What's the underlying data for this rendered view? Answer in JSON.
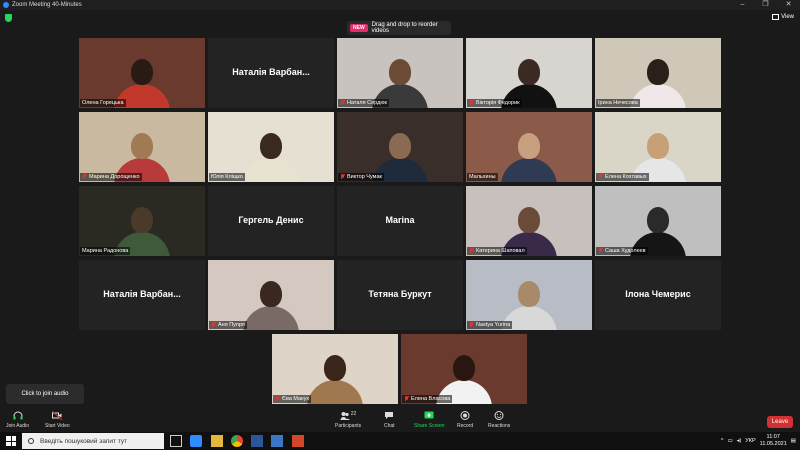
{
  "window": {
    "title": "Zoom Meeting 40-Minutes",
    "controls": [
      "–",
      "❐",
      "✕"
    ]
  },
  "banner": {
    "badge": "NEW",
    "text": "Drag and drop to reorder videos"
  },
  "view_label": "View",
  "tiles": [
    {
      "name": "Олена Горецька",
      "type": "video",
      "muted": false,
      "active": true,
      "bg": "#6b3a2e",
      "head": "#2a1a14",
      "body": "#c0392b"
    },
    {
      "name": "Наталія Варбан...",
      "type": "name"
    },
    {
      "name": "Наталя Сердюк",
      "type": "video",
      "muted": true,
      "bg": "#c9c3bf",
      "head": "#6b4a36",
      "body": "#3a3a3a"
    },
    {
      "name": "Вікторія Федорик",
      "type": "video",
      "muted": true,
      "bg": "#d8d4cf",
      "head": "#3b2a22",
      "body": "#111111"
    },
    {
      "name": "Ірина Нечесова",
      "type": "video",
      "muted": false,
      "bg": "#cfc7b8",
      "head": "#2a201a",
      "body": "#f0e8e8"
    },
    {
      "name": "Марина Дорощенко",
      "type": "video",
      "muted": true,
      "bg": "#c8b9a0",
      "head": "#a07a55",
      "body": "#b83a3a"
    },
    {
      "name": "Юлія Кліщко",
      "type": "video",
      "muted": false,
      "bg": "#e5e0d2",
      "head": "#3a2a1e",
      "body": "#e8e2d0"
    },
    {
      "name": "Виктор Чумак",
      "type": "video",
      "muted": true,
      "bg": "#3a2e2a",
      "head": "#8a6a50",
      "body": "#1f2a3a"
    },
    {
      "name": "Мальхины",
      "type": "video",
      "muted": false,
      "bg": "#8c5a48",
      "head": "#c8a080",
      "body": "#2f3b52"
    },
    {
      "name": "Елена Кохтавых",
      "type": "video",
      "muted": true,
      "bg": "#d9d6c8",
      "head": "#c8a078",
      "body": "#e6e6e6"
    },
    {
      "name": "Марина Радонова",
      "type": "video",
      "muted": false,
      "bg": "#2a2a22",
      "head": "#4a3a2a",
      "body": "#3f5a3a"
    },
    {
      "name": "Гергель Денис",
      "type": "name"
    },
    {
      "name": "Marina",
      "type": "name"
    },
    {
      "name": "Катерина Шаповал",
      "type": "video",
      "muted": true,
      "bg": "#c7c0bd",
      "head": "#6a4a38",
      "body": "#3a2a4a"
    },
    {
      "name": "Саша Худолеев",
      "type": "video",
      "muted": true,
      "bg": "#bfbfbf",
      "head": "#2a2a2a",
      "body": "#151515"
    },
    {
      "name": "Наталія Варбан...",
      "type": "name"
    },
    {
      "name": "Аня Пупря",
      "type": "video",
      "muted": true,
      "bg": "#d5c8c0",
      "head": "#3a2820",
      "body": "#7a6a66"
    },
    {
      "name": "Тетяна Буркут",
      "type": "name"
    },
    {
      "name": "Nastya Yurina",
      "type": "video",
      "muted": true,
      "bg": "#b8bcc4",
      "head": "#a88a6a",
      "body": "#d8d8d8"
    },
    {
      "name": "Ілона Чемерис",
      "type": "name"
    },
    {
      "name": "Єва Макух",
      "type": "video",
      "muted": true,
      "bg": "#ded4c8",
      "head": "#3a2618",
      "body": "#a07850"
    },
    {
      "name": "Елена Власова",
      "type": "video",
      "muted": true,
      "bg": "#6a3a2e",
      "head": "#2a1610",
      "body": "#f2f2f2"
    }
  ],
  "join_audio_popup": "Click to join audio",
  "toolbar": {
    "join_audio": "Join Audio",
    "start_video": "Start Video",
    "participants": "Participants",
    "participants_count": "22",
    "chat": "Chat",
    "share_screen": "Share Screen",
    "record": "Record",
    "reactions": "Reactions",
    "leave": "Leave"
  },
  "taskbar": {
    "search_placeholder": "Введіть пошуковий запит тут",
    "language": "УКР",
    "time": "11:07",
    "date": "11.05.2021"
  },
  "colors": {
    "accent_green": "#23d959",
    "leave_red": "#d23131",
    "active_speaker": "#d8e23a",
    "new_badge": "#e02f6a"
  }
}
